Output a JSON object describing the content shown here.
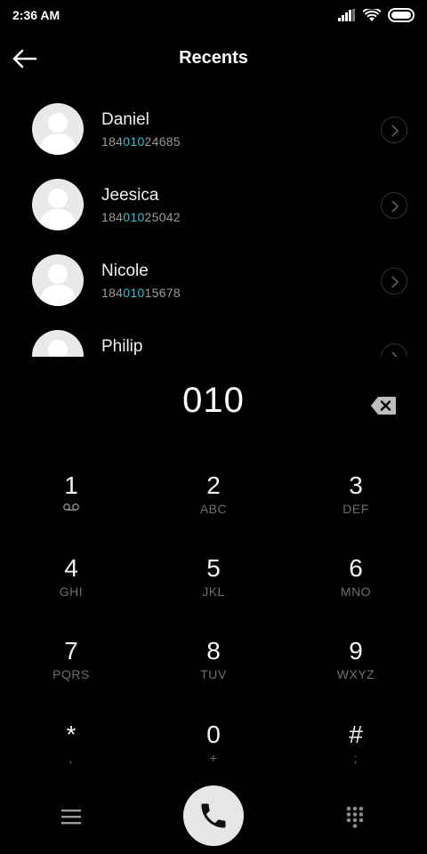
{
  "status_bar": {
    "time": "2:36 AM"
  },
  "header": {
    "title": "Recents"
  },
  "contacts": [
    {
      "name": "Daniel",
      "number_prefix": "184",
      "number_match": "010",
      "number_suffix": "24685"
    },
    {
      "name": "Jeesica",
      "number_prefix": "184",
      "number_match": "010",
      "number_suffix": "25042"
    },
    {
      "name": "Nicole",
      "number_prefix": "184",
      "number_match": "010",
      "number_suffix": "15678"
    },
    {
      "name": "Philip",
      "number_prefix": "",
      "number_match": "",
      "number_suffix": ""
    }
  ],
  "dialed": "010",
  "keypad": [
    {
      "digit": "1",
      "letters": ""
    },
    {
      "digit": "2",
      "letters": "ABC"
    },
    {
      "digit": "3",
      "letters": "DEF"
    },
    {
      "digit": "4",
      "letters": "GHI"
    },
    {
      "digit": "5",
      "letters": "JKL"
    },
    {
      "digit": "6",
      "letters": "MNO"
    },
    {
      "digit": "7",
      "letters": "PQRS"
    },
    {
      "digit": "8",
      "letters": "TUV"
    },
    {
      "digit": "9",
      "letters": "WXYZ"
    },
    {
      "digit": "*",
      "letters": ","
    },
    {
      "digit": "0",
      "letters": "+"
    },
    {
      "digit": "#",
      "letters": ";"
    }
  ],
  "icons": {
    "signal": "signal-icon",
    "wifi": "wifi-icon",
    "battery": "battery-icon",
    "back": "back-arrow-icon",
    "avatar": "avatar-placeholder-icon",
    "chevron": "chevron-right-icon",
    "backspace": "backspace-icon",
    "voicemail": "voicemail-icon",
    "menu": "menu-icon",
    "call": "phone-call-icon",
    "dialpad": "dialpad-icon"
  },
  "colors": {
    "highlight": "#25c6d6",
    "background": "#000000",
    "call_button": "#e6e6e6"
  }
}
